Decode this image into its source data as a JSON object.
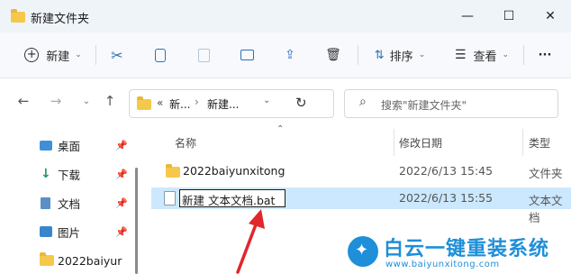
{
  "window": {
    "title": "新建文件夹",
    "controls": {
      "minimize": "—",
      "maximize": "☐",
      "close": "✕"
    }
  },
  "toolbar": {
    "new_label": "新建",
    "sort_label": "排序",
    "view_label": "查看",
    "more_label": "···"
  },
  "nav": {
    "breadcrumb": [
      "«",
      "新...",
      "›",
      "新建..."
    ],
    "search_placeholder": "搜索\"新建文件夹\""
  },
  "sidebar": {
    "items": [
      {
        "label": "桌面",
        "icon": "desktop-icon",
        "pinned": true
      },
      {
        "label": "下载",
        "icon": "download-icon",
        "pinned": true
      },
      {
        "label": "文档",
        "icon": "document-icon",
        "pinned": true
      },
      {
        "label": "图片",
        "icon": "picture-icon",
        "pinned": true
      },
      {
        "label": "2022baiyur",
        "icon": "folder-icon",
        "pinned": false
      }
    ]
  },
  "list": {
    "columns": {
      "name": "名称",
      "modified": "修改日期",
      "type": "类型"
    },
    "rows": [
      {
        "name": "2022baiyunxitong",
        "modified": "2022/6/13 15:45",
        "type": "文件夹",
        "icon": "folder-icon"
      },
      {
        "name": "新建 文本文档.bat",
        "modified": "2022/6/13 15:55",
        "type": "文本文档",
        "icon": "text-file-icon",
        "renaming": true
      }
    ]
  },
  "watermark": {
    "brand": "白云一键重装系统",
    "url": "www.baiyunxitong.com",
    "color": "#1e8fd8"
  },
  "colors": {
    "accent": "#0067c0",
    "selection": "#cce8ff",
    "arrow": "#e1262c"
  }
}
